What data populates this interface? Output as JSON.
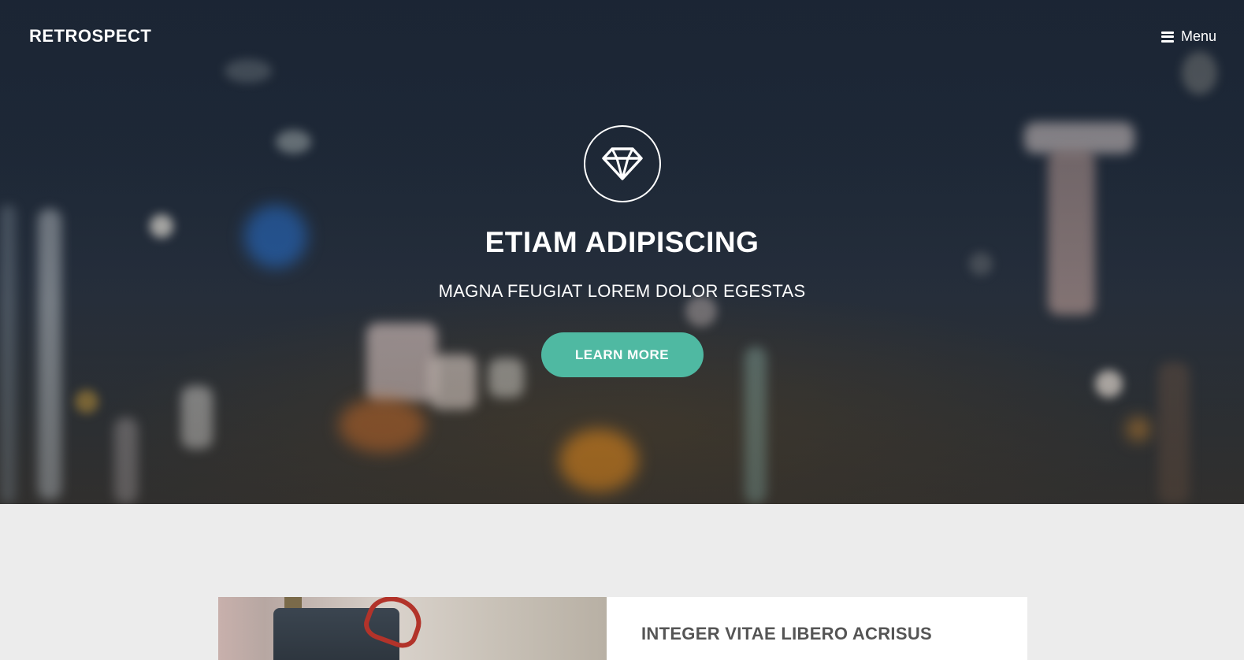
{
  "header": {
    "brand": "RETROSPECT",
    "menu_label": "Menu",
    "menu_icon": "hamburger-icon"
  },
  "hero": {
    "icon": "diamond-icon",
    "title": "ETIAM ADIPISCING",
    "subtitle": "MAGNA FEUGIAT LOREM DOLOR EGESTAS",
    "cta_label": "LEARN MORE"
  },
  "feature_card": {
    "title": "INTEGER VITAE LIBERO ACRISUS"
  },
  "colors": {
    "accent": "#4fb9a2",
    "hero_bg": "#1f2a39",
    "section_bg": "#ececec",
    "card_title": "#555555"
  }
}
